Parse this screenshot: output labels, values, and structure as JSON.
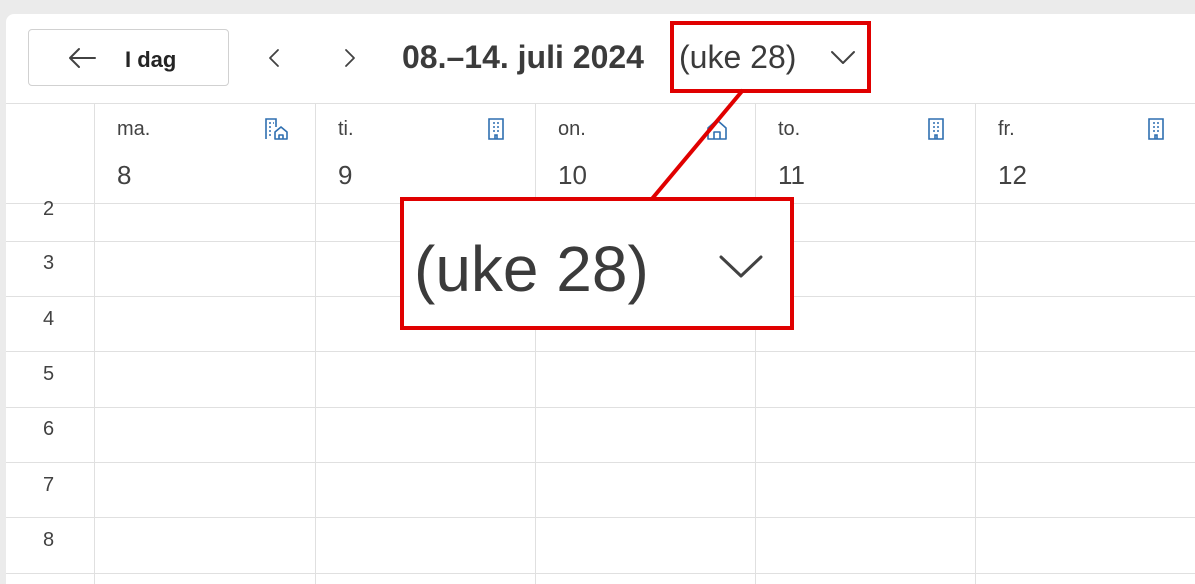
{
  "toolbar": {
    "today_label": "I dag",
    "date_range": "08.–14. juli 2024",
    "week_label": "(uke 28)"
  },
  "days": [
    {
      "abbr": "ma.",
      "num": "8",
      "location_icon": "building-home-icon"
    },
    {
      "abbr": "ti.",
      "num": "9",
      "location_icon": "building-icon"
    },
    {
      "abbr": "on.",
      "num": "10",
      "location_icon": "home-icon"
    },
    {
      "abbr": "to.",
      "num": "11",
      "location_icon": "building-icon"
    },
    {
      "abbr": "fr.",
      "num": "12",
      "location_icon": "building-icon"
    }
  ],
  "hours": [
    "2",
    "3",
    "4",
    "5",
    "6",
    "7",
    "8"
  ],
  "annotation": {
    "zoom_text": "(uke 28)",
    "highlight_color": "#e00000"
  }
}
